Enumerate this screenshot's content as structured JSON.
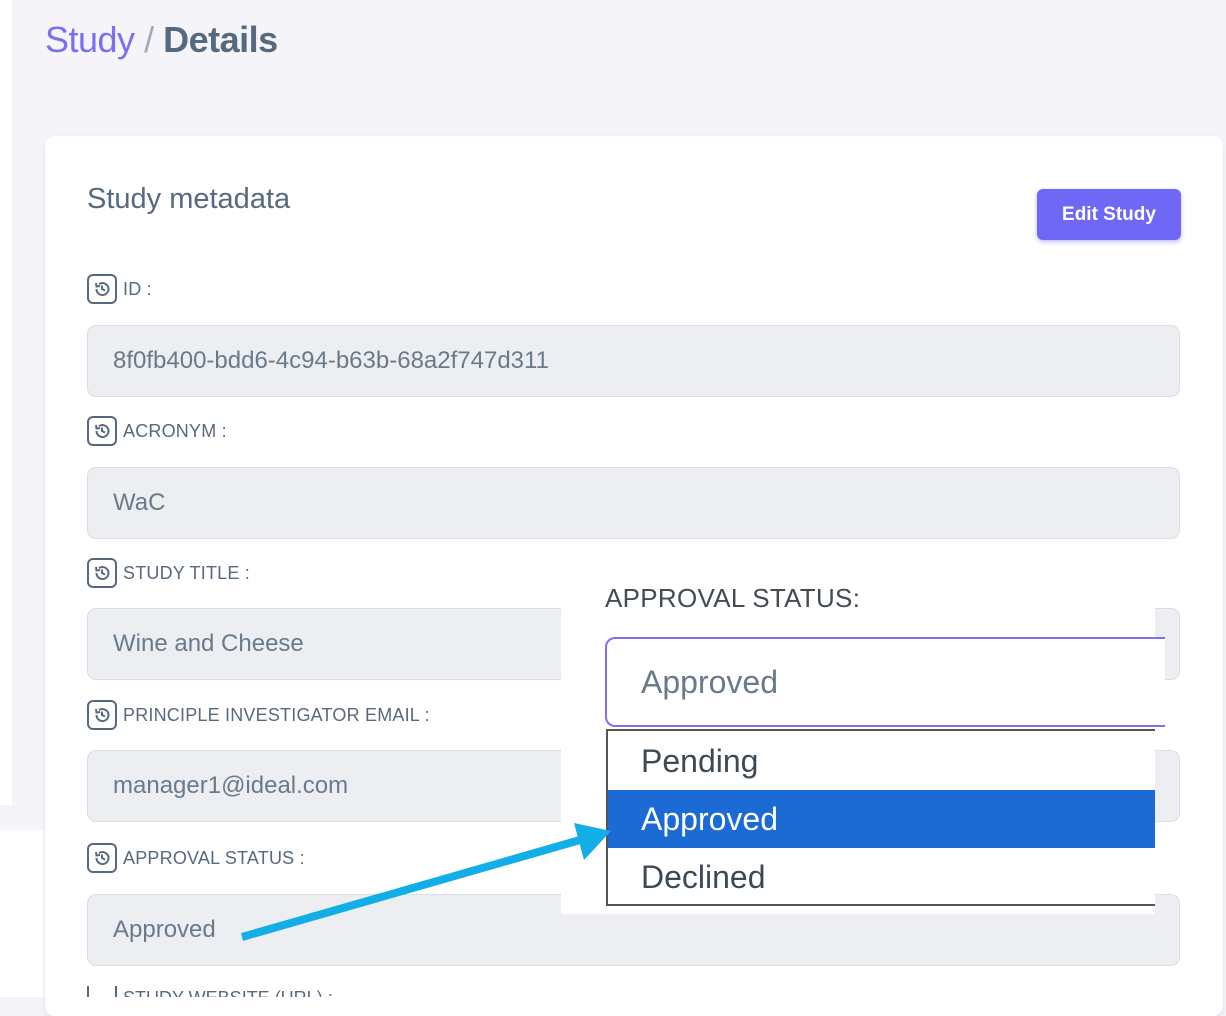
{
  "breadcrumb": {
    "parent": "Study",
    "separator": "/",
    "current": "Details"
  },
  "card": {
    "title": "Study metadata",
    "edit_button": "Edit Study"
  },
  "fields": [
    {
      "label": "ID :",
      "value": "8f0fb400-bdd6-4c94-b63b-68a2f747d311"
    },
    {
      "label": "ACRONYM :",
      "value": "WaC"
    },
    {
      "label": "STUDY TITLE :",
      "value": "Wine and Cheese"
    },
    {
      "label": "PRINCIPLE INVESTIGATOR EMAIL :",
      "value": "manager1@ideal.com"
    },
    {
      "label": "APPROVAL STATUS :",
      "value": "Approved"
    },
    {
      "label": "STUDY WEBSITE (URL) :"
    }
  ],
  "callout": {
    "label": "APPROVAL STATUS:",
    "selected_value": "Approved",
    "options": [
      "Pending",
      "Approved",
      "Declined"
    ],
    "highlighted_option": "Approved"
  },
  "colors": {
    "accent": "#6f67f6",
    "breadcrumb_link": "#7a6ff0",
    "option_highlight": "#1c6ad4",
    "arrow": "#12aee8",
    "field_background": "#eceef1"
  },
  "icons": {
    "field_history": "history-icon",
    "annotation_arrow": "arrow-icon"
  }
}
